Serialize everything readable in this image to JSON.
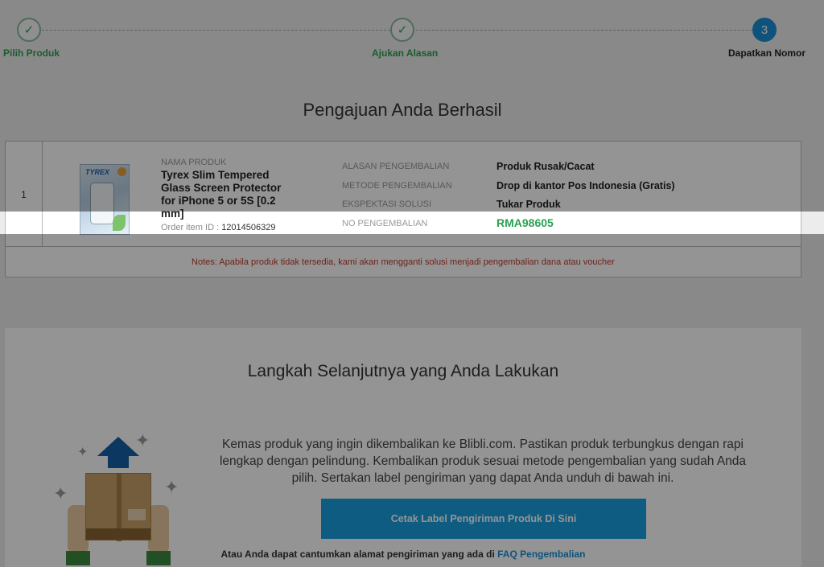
{
  "stepper": {
    "steps": [
      {
        "label": "Pilih Produk",
        "icon": "check-icon",
        "status": "done"
      },
      {
        "label": "Ajukan Alasan",
        "icon": "check-icon",
        "status": "done"
      },
      {
        "label": "Dapatkan Nomor",
        "number": "3",
        "status": "active"
      }
    ],
    "check_glyph": "✓"
  },
  "title": "Pengajuan Anda Berhasil",
  "product_row": {
    "index": "1",
    "image_brand": "TYREX",
    "name_label": "NAMA PRODUK",
    "name": "Tyrex Slim Tempered Glass Screen Protector for iPhone 5 or 5S [0.2 mm]",
    "order_item_label": "Order item ID :",
    "order_item_id": "12014506329",
    "fields": [
      {
        "label": "ALASAN PENGEMBALIAN",
        "value": "Produk Rusak/Cacat"
      },
      {
        "label": "METODE PENGEMBALIAN",
        "value": "Drop di kantor Pos Indonesia (Gratis)"
      },
      {
        "label": "EKSPEKTASI SOLUSI",
        "value": "Tukar Produk"
      },
      {
        "label": "NO PENGEMBALIAN",
        "value": "RMA98605"
      }
    ]
  },
  "notes": "Notes: Apabila produk tidak tersedia, kami akan mengganti solusi menjadi pengembalian dana atau voucher",
  "next_steps": {
    "title": "Langkah Selanjutnya yang Anda Lakukan",
    "description": "Kemas produk yang ingin dikembalikan ke Blibli.com. Pastikan produk terbungkus dengan rapi lengkap dengan pelindung. Kembalikan produk sesuai metode pengembalian yang sudah Anda pilih. Sertakan label pengiriman yang dapat Anda unduh di bawah ini.",
    "print_button": "Cetak Label Pengiriman Produk Di Sini",
    "alt_text": "Atau Anda dapat cantumkan alamat pengiriman yang ada di",
    "alt_link": "FAQ Pengembalian"
  },
  "colors": {
    "success": "#2aa052",
    "accent": "#1a8fd8",
    "button": "#1a9fe0",
    "notes": "#c0392b"
  }
}
